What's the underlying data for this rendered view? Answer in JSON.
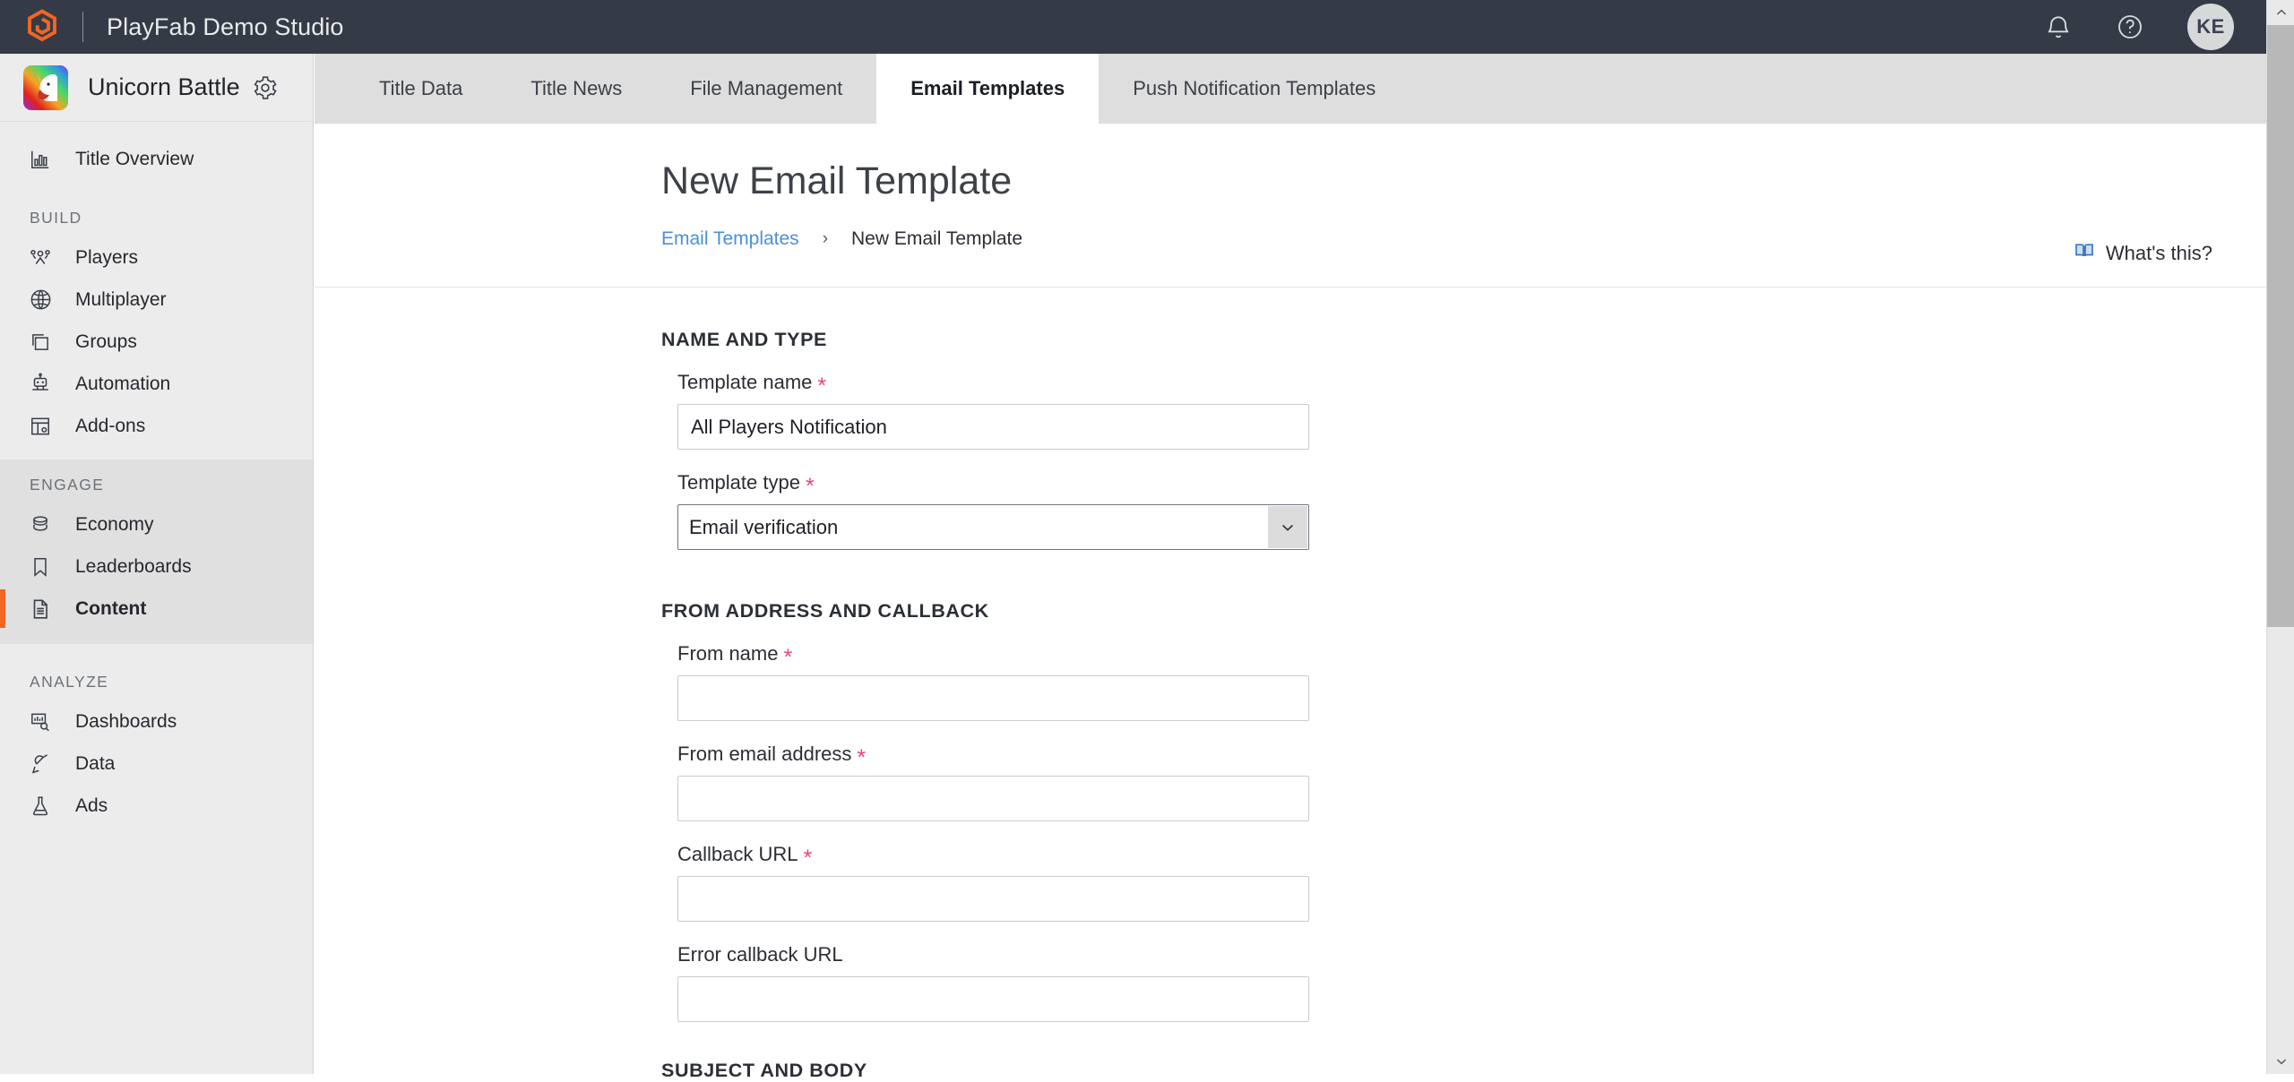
{
  "topbar": {
    "title": "PlayFab Demo Studio",
    "logo_icon": "playfab-logo-icon",
    "notifications_icon": "bell-icon",
    "help_icon": "question-circle-icon",
    "avatar_initials": "KE",
    "background_color": "#343b46"
  },
  "sidebar": {
    "studio_name": "Unicorn Battle",
    "studio_thumb_icon": "unicorn-avatar-icon",
    "settings_icon": "gear-icon",
    "accent_color": "#f26522",
    "overview": {
      "label": "Title Overview",
      "icon": "bar-chart-icon"
    },
    "groups": [
      {
        "label": "BUILD",
        "active": false,
        "items": [
          {
            "label": "Players",
            "icon": "people-icon",
            "selected": false
          },
          {
            "label": "Multiplayer",
            "icon": "globe-icon",
            "selected": false
          },
          {
            "label": "Groups",
            "icon": "stacked-squares-icon",
            "selected": false
          },
          {
            "label": "Automation",
            "icon": "robot-icon",
            "selected": false
          },
          {
            "label": "Add-ons",
            "icon": "addons-grid-icon",
            "selected": false
          }
        ]
      },
      {
        "label": "ENGAGE",
        "active": true,
        "items": [
          {
            "label": "Economy",
            "icon": "coins-stack-icon",
            "selected": false
          },
          {
            "label": "Leaderboards",
            "icon": "bookmark-icon",
            "selected": false
          },
          {
            "label": "Content",
            "icon": "document-icon",
            "selected": true
          }
        ]
      },
      {
        "label": "ANALYZE",
        "active": false,
        "items": [
          {
            "label": "Dashboards",
            "icon": "dashboard-search-icon",
            "selected": false
          },
          {
            "label": "Data",
            "icon": "plug-icon",
            "selected": false
          },
          {
            "label": "Ads",
            "icon": "flask-icon",
            "selected": false
          }
        ]
      }
    ]
  },
  "tabs": [
    {
      "label": "Title Data",
      "active": false
    },
    {
      "label": "Title News",
      "active": false
    },
    {
      "label": "File Management",
      "active": false
    },
    {
      "label": "Email Templates",
      "active": true
    },
    {
      "label": "Push Notification Templates",
      "active": false
    }
  ],
  "page": {
    "title": "New Email Template",
    "breadcrumb": {
      "parent": "Email Templates",
      "separator": "›",
      "current": "New Email Template"
    },
    "whats_this": {
      "label": "What's this?",
      "icon": "book-icon",
      "icon_color": "#3b78c3"
    }
  },
  "form": {
    "sections": [
      {
        "title": "NAME AND TYPE",
        "fields": [
          {
            "label": "Template name",
            "required": true,
            "control": "text",
            "value": "All Players Notification",
            "placeholder": ""
          },
          {
            "label": "Template type",
            "required": true,
            "control": "select",
            "value": "Email verification",
            "chevron_icon": "chevron-down-icon"
          }
        ]
      },
      {
        "title": "FROM ADDRESS AND CALLBACK",
        "fields": [
          {
            "label": "From name",
            "required": true,
            "control": "text",
            "value": "",
            "placeholder": ""
          },
          {
            "label": "From email address",
            "required": true,
            "control": "text",
            "value": "",
            "placeholder": ""
          },
          {
            "label": "Callback URL",
            "required": true,
            "control": "text",
            "value": "",
            "placeholder": ""
          },
          {
            "label": "Error callback URL",
            "required": false,
            "control": "text",
            "value": "",
            "placeholder": ""
          }
        ]
      },
      {
        "title": "SUBJECT AND BODY",
        "fields": []
      }
    ],
    "required_marker": "*",
    "required_color": "#e8447a"
  },
  "scrollbar": {
    "up_icon": "chevron-up-icon",
    "down_icon": "chevron-down-icon",
    "thumb_color": "#b8b8b8",
    "track_color": "#e9e9e9"
  }
}
